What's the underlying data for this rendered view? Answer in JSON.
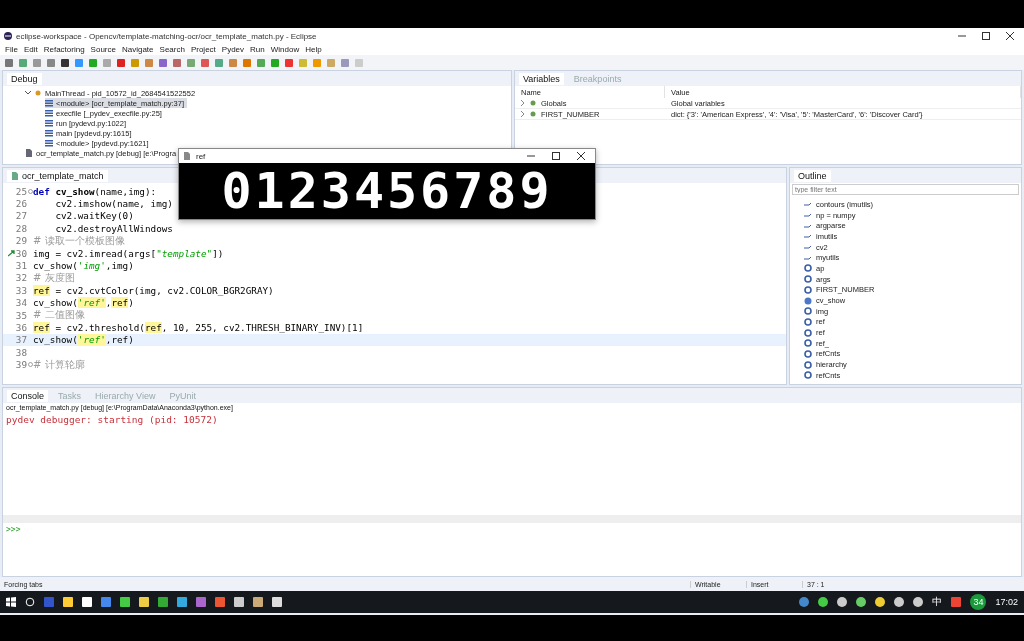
{
  "window": {
    "title": "eclipse-workspace - Opencv/template-matching-ocr/ocr_template_match.py - Eclipse"
  },
  "menu": [
    "File",
    "Edit",
    "Refactoring",
    "Source",
    "Navigate",
    "Search",
    "Project",
    "Pydev",
    "Run",
    "Window",
    "Help"
  ],
  "debug": {
    "tab": {
      "label": "Debug",
      "selected": true
    },
    "tree": [
      {
        "label": "MainThread - pid_10572_id_2684541522552",
        "kind": "thread",
        "expanded": true,
        "children": [
          {
            "label": "<module> [ocr_template_match.py:37]",
            "kind": "frame",
            "selected": true
          },
          {
            "label": "execfile [_pydev_execfile.py:25]",
            "kind": "frame",
            "selected": false
          },
          {
            "label": "run [pydevd.py:1022]",
            "kind": "frame",
            "selected": false
          },
          {
            "label": "main [pydevd.py:1615]",
            "kind": "frame",
            "selected": false
          },
          {
            "label": "<module> [pydevd.py:1621]",
            "kind": "frame",
            "selected": false
          }
        ]
      },
      {
        "label": "ocr_template_match.py [debug] [e:\\Progra",
        "kind": "process",
        "expanded": false
      }
    ]
  },
  "variables": {
    "tabs": [
      {
        "label": "Variables",
        "selected": true
      },
      {
        "label": "Breakpoints",
        "selected": false
      }
    ],
    "columns": [
      "Name",
      "Value"
    ],
    "rows": [
      {
        "name": "Globals",
        "value": "Global variables"
      },
      {
        "name": "FIRST_NUMBER",
        "value": "dict: {'3': 'American Express', '4': 'Visa', '5': 'MasterCard', '6': 'Discover Card'}"
      }
    ]
  },
  "editor": {
    "tab": {
      "label": "ocr_template_match",
      "selected": true
    },
    "lines": [
      {
        "number": "25",
        "current": false,
        "foldable": true,
        "segments": [
          {
            "kind": "keyword",
            "text": "def "
          },
          {
            "kind": "bold",
            "text": "cv_show"
          },
          {
            "kind": "plain",
            "text": "(name,img):"
          }
        ]
      },
      {
        "number": "26",
        "current": false,
        "segments": [
          {
            "kind": "plain",
            "text": "    cv2.imshow(name, img)"
          }
        ]
      },
      {
        "number": "27",
        "current": false,
        "segments": [
          {
            "kind": "plain",
            "text": "    cv2.waitKey(0)"
          }
        ]
      },
      {
        "number": "28",
        "current": false,
        "segments": [
          {
            "kind": "plain",
            "text": "    cv2.destroyAllWindows"
          }
        ]
      },
      {
        "number": "29",
        "current": false,
        "segments": [
          {
            "kind": "comment",
            "text": "# 读取一个模板图像"
          }
        ]
      },
      {
        "number": "30",
        "current": false,
        "instruction_pointer": true,
        "segments": [
          {
            "kind": "plain",
            "text": "img = cv2.imread(args["
          },
          {
            "kind": "string",
            "text": "\"template\""
          },
          {
            "kind": "plain",
            "text": "])"
          }
        ]
      },
      {
        "number": "31",
        "current": false,
        "segments": [
          {
            "kind": "plain",
            "text": "cv_show("
          },
          {
            "kind": "string",
            "text": "'img'"
          },
          {
            "kind": "plain",
            "text": ",img)"
          }
        ]
      },
      {
        "number": "32",
        "current": false,
        "segments": [
          {
            "kind": "comment",
            "text": "# 灰度图"
          }
        ]
      },
      {
        "number": "33",
        "current": false,
        "segments": [
          {
            "kind": "highlight",
            "text": "ref"
          },
          {
            "kind": "plain",
            "text": " = cv2.cvtColor(img, cv2.COLOR_BGR2GRAY)"
          }
        ]
      },
      {
        "number": "34",
        "current": false,
        "segments": [
          {
            "kind": "plain",
            "text": "cv_show("
          },
          {
            "kind": "hstring",
            "text": "'ref'"
          },
          {
            "kind": "plain",
            "text": ","
          },
          {
            "kind": "highlight",
            "text": "ref"
          },
          {
            "kind": "plain",
            "text": ")"
          }
        ]
      },
      {
        "number": "35",
        "current": false,
        "segments": [
          {
            "kind": "comment",
            "text": "# 二值图像"
          }
        ]
      },
      {
        "number": "36",
        "current": false,
        "segments": [
          {
            "kind": "highlight",
            "text": "ref"
          },
          {
            "kind": "plain",
            "text": " = cv2.threshold("
          },
          {
            "kind": "highlight",
            "text": "ref"
          },
          {
            "kind": "plain",
            "text": ", 10, 255, cv2.THRESH_BINARY_INV)[1]"
          }
        ]
      },
      {
        "number": "37",
        "current": true,
        "segments": [
          {
            "kind": "plain",
            "text": "cv_show("
          },
          {
            "kind": "hstring",
            "text": "'ref'"
          },
          {
            "kind": "plain",
            "text": ",ref)"
          }
        ]
      },
      {
        "number": "38",
        "current": false
      },
      {
        "number": "39",
        "current": false,
        "foldable": true,
        "segments": [
          {
            "kind": "comment",
            "text": "# 计算轮廓"
          }
        ]
      }
    ]
  },
  "outline": {
    "tab": {
      "label": "Outline",
      "selected": true
    },
    "filter": {
      "placeholder": "type filter text"
    },
    "items": [
      {
        "label": "contours (imutils)",
        "kind": "import"
      },
      {
        "label": "np = numpy",
        "kind": "import"
      },
      {
        "label": "argparse",
        "kind": "import"
      },
      {
        "label": "imutils",
        "kind": "import"
      },
      {
        "label": "cv2",
        "kind": "import"
      },
      {
        "label": "myutils",
        "kind": "import"
      },
      {
        "label": "ap",
        "kind": "attribute"
      },
      {
        "label": "args",
        "kind": "attribute"
      },
      {
        "label": "FIRST_NUMBER",
        "kind": "attribute"
      },
      {
        "label": "cv_show",
        "kind": "function"
      },
      {
        "label": "img",
        "kind": "attribute"
      },
      {
        "label": "ref",
        "kind": "attribute"
      },
      {
        "label": "ref",
        "kind": "attribute"
      },
      {
        "label": "ref_",
        "kind": "attribute"
      },
      {
        "label": "refCnts",
        "kind": "attribute"
      },
      {
        "label": "hierarchy",
        "kind": "attribute"
      },
      {
        "label": "refCnts",
        "kind": "attribute"
      }
    ]
  },
  "ref_window": {
    "title": "ref",
    "digits": "0123456789"
  },
  "console": {
    "tabs": [
      {
        "label": "Console",
        "selected": true
      },
      {
        "label": "Tasks",
        "selected": false
      },
      {
        "label": "Hierarchy View",
        "selected": false
      },
      {
        "label": "PyUnit",
        "selected": false
      }
    ],
    "process": "ocr_template_match.py [debug] [e:\\ProgramData\\Anaconda3\\python.exe]",
    "output": "pydev debugger: starting (pid: 10572)",
    "prompt": ">>>"
  },
  "status_bar": {
    "message": "Forcing tabs",
    "mode": "Writable",
    "insert": "Insert",
    "position": "37 : 1"
  },
  "taskbar": {
    "ime": "中",
    "badge": "34",
    "time": "17:02"
  }
}
